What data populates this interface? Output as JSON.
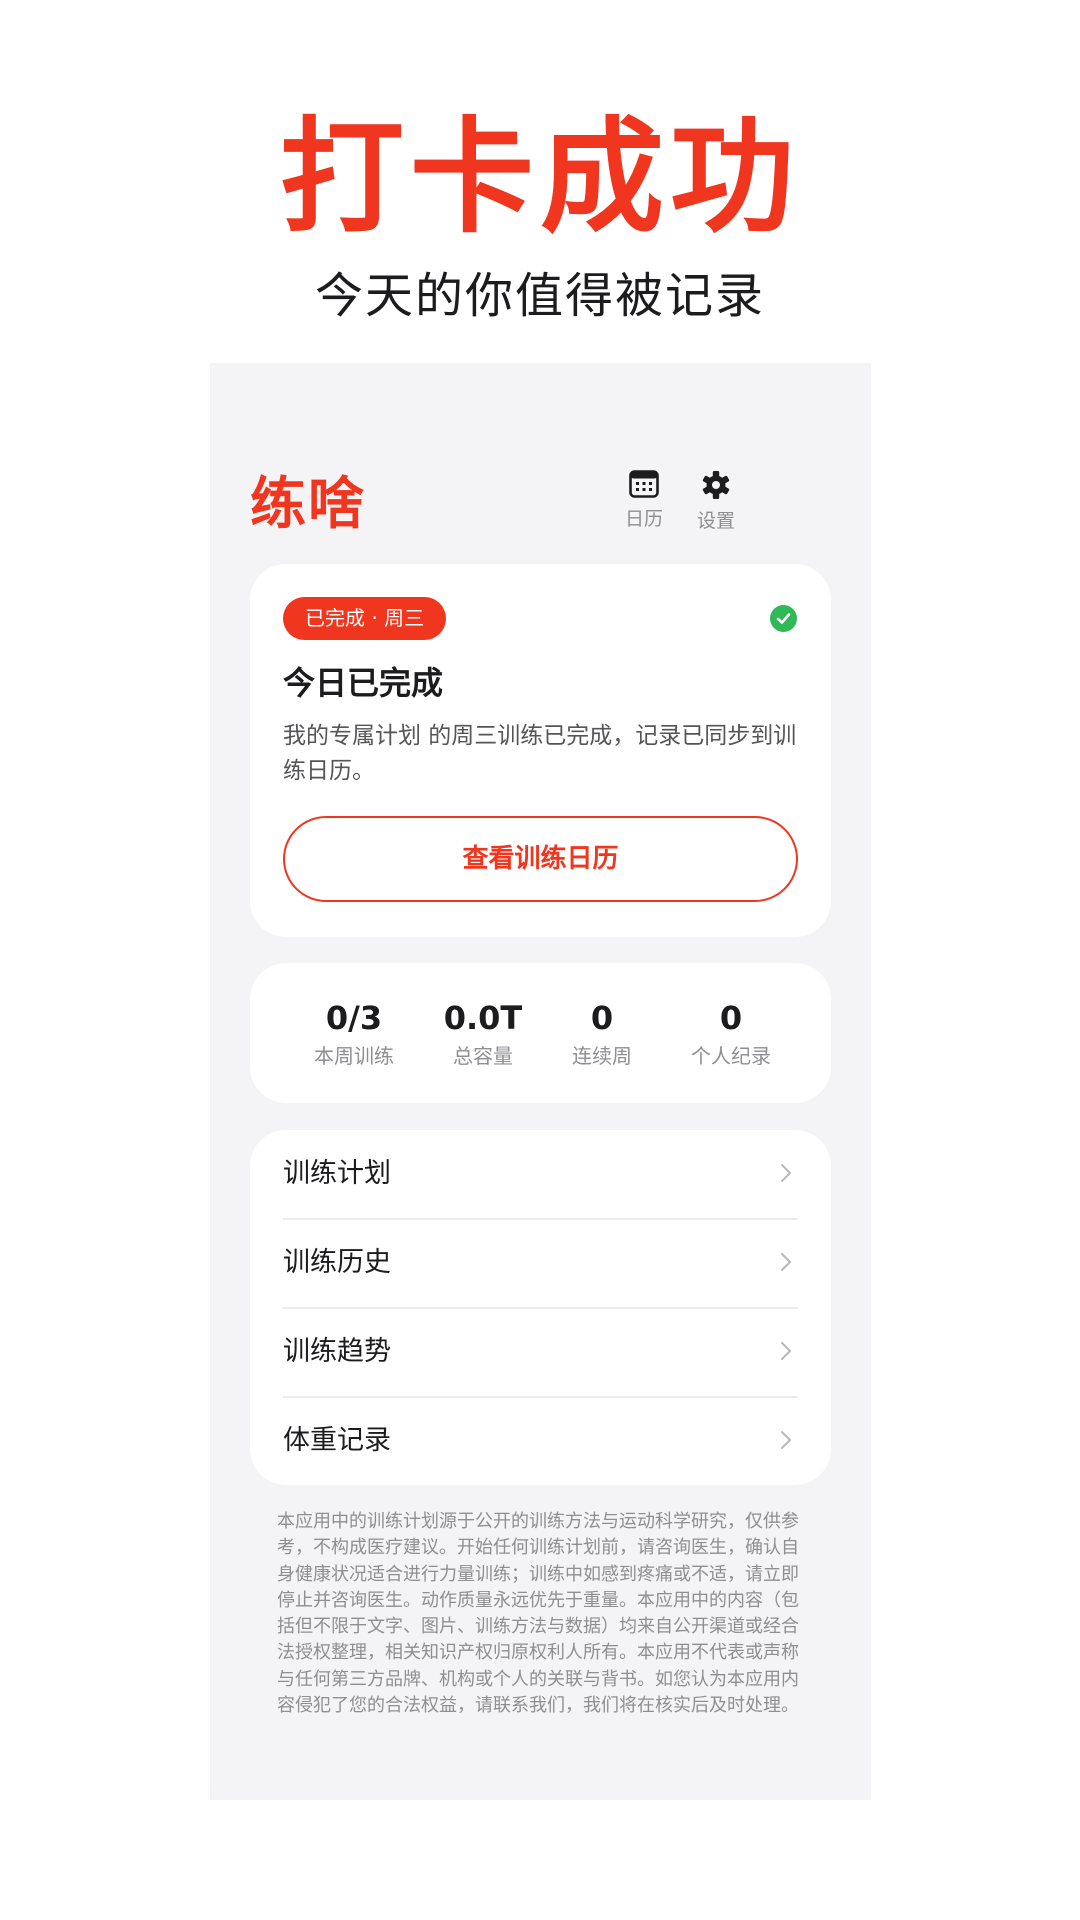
{
  "hero": {
    "title": "打卡成功",
    "subtitle": "今天的你值得被记录"
  },
  "app": {
    "brand": "练啥",
    "actions": [
      {
        "label": "日历",
        "icon": "calendar-icon"
      },
      {
        "label": "设置",
        "icon": "gear-icon"
      }
    ]
  },
  "today_card": {
    "badge": "已完成 · 周三",
    "title": "今日已完成",
    "description": "我的专属计划 的周三训练已完成，记录已同步到训练日历。",
    "button_label": "查看训练日历",
    "status_icon": "check-circle-icon"
  },
  "stats": [
    {
      "value": "0/3",
      "label": "本周训练"
    },
    {
      "value": "0.0T",
      "label": "总容量"
    },
    {
      "value": "0",
      "label": "连续周"
    },
    {
      "value": "0",
      "label": "个人纪录"
    }
  ],
  "menu": [
    {
      "label": "训练计划"
    },
    {
      "label": "训练历史"
    },
    {
      "label": "训练趋势"
    },
    {
      "label": "体重记录"
    }
  ],
  "disclaimer": "本应用中的训练计划源于公开的训练方法与运动科学研究，仅供参考，不构成医疗建议。开始任何训练计划前，请咨询医生，确认自身健康状况适合进行力量训练；训练中如感到疼痛或不适，请立即停止并咨询医生。动作质量永远优先于重量。本应用中的内容（包括但不限于文字、图片、训练方法与数据）均来自公开渠道或经合法授权整理，相关知识产权归原权利人所有。本应用不代表或声称与任何第三方品牌、机构或个人的关联与背书。如您认为本应用内容侵犯了您的合法权益，请联系我们，我们将在核实后及时处理。",
  "colors": {
    "accent": "#f0361e",
    "success": "#2fb957",
    "background": "#f4f4f6"
  }
}
